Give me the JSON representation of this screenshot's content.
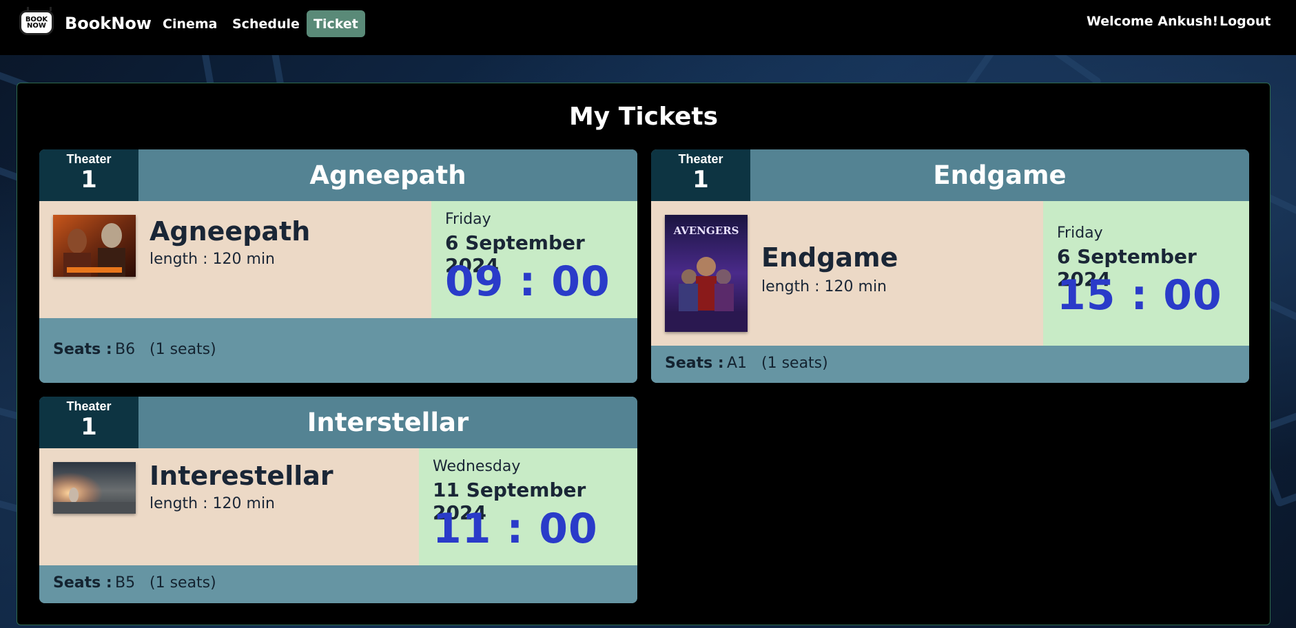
{
  "navbar": {
    "logo_text_1": "BOOK",
    "logo_text_2": "NOW",
    "brand": "BookNow",
    "links": [
      "Cinema",
      "Schedule",
      "Ticket"
    ],
    "active_link": "Ticket",
    "welcome": "Welcome Ankush!",
    "logout": "Logout"
  },
  "page_title": "My Tickets",
  "tickets": [
    {
      "theater_label": "Theater",
      "theater_number": "1",
      "title": "Agneepath",
      "movie_name": "Agneepath",
      "length": "length : 120 min",
      "day": "Friday",
      "date": "6 September 2024",
      "time": "09 : 00",
      "seats_label": "Seats :",
      "seats": "B6",
      "seat_count": "(1 seats)"
    },
    {
      "theater_label": "Theater",
      "theater_number": "1",
      "title": "Endgame",
      "movie_name": "Endgame",
      "length": "length : 120 min",
      "day": "Friday",
      "date": "6 September 2024",
      "time": "15 : 00",
      "seats_label": "Seats :",
      "seats": "A1",
      "seat_count": "(1 seats)",
      "poster_text": "AVENGERS"
    },
    {
      "theater_label": "Theater",
      "theater_number": "1",
      "title": "Interstellar",
      "movie_name": "Interestellar",
      "length": "length : 120 min",
      "day": "Wednesday",
      "date": "11 September 2024",
      "time": "11 : 00",
      "seats_label": "Seats :",
      "seats": "B5",
      "seat_count": "(1 seats)"
    }
  ],
  "colors": {
    "navbar_bg": "#000000",
    "active_tab": "#5a8a78",
    "card_header": "#548393",
    "theater_box": "#0d3442",
    "info_bg": "#ecd9c6",
    "date_bg": "#c8ebc6",
    "time_color": "#2a3bc9",
    "seats_bg": "#6695a3"
  }
}
